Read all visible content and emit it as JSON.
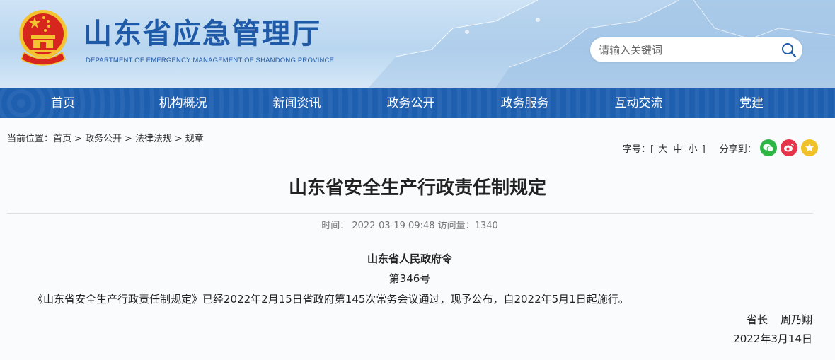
{
  "header": {
    "title": "山东省应急管理厅",
    "subtitle": "DEPARTMENT OF EMERGENCY MANAGEMENT OF SHANDONG PROVINCE",
    "search_placeholder": "请输入关键词"
  },
  "nav": {
    "items": [
      "首页",
      "机构概况",
      "新闻资讯",
      "政务公开",
      "政务服务",
      "互动交流",
      "党建"
    ]
  },
  "breadcrumb": {
    "prefix": "当前位置：",
    "items": [
      "首页",
      "政务公开",
      "法律法规",
      "规章"
    ],
    "separator": ">"
  },
  "tools": {
    "font_size_label": "字号：",
    "font_sizes": [
      "大",
      "中",
      "小"
    ],
    "share_label": "分享到：",
    "share_icons": [
      "wechat-icon",
      "weibo-icon",
      "favorite-icon"
    ]
  },
  "article": {
    "title": "山东省安全生产行政责任制规定",
    "time_label": "时间：",
    "time": "2022-03-19 09:48",
    "views_label": "访问量：",
    "views": "1340",
    "decree_org": "山东省人民政府令",
    "decree_no": "第346号",
    "body": "《山东省安全生产行政责任制规定》已经2022年2月15日省政府第145次常务会议通过，现予公布，自2022年5月1日起施行。",
    "signer_title": "省长",
    "signer_name": "周乃翔",
    "sign_date": "2022年3月14日"
  },
  "colors": {
    "nav_bg": "#1f5fb0",
    "title_blue": "#1e5aa8",
    "emblem_red": "#d7261e",
    "emblem_gold": "#f4c430"
  }
}
